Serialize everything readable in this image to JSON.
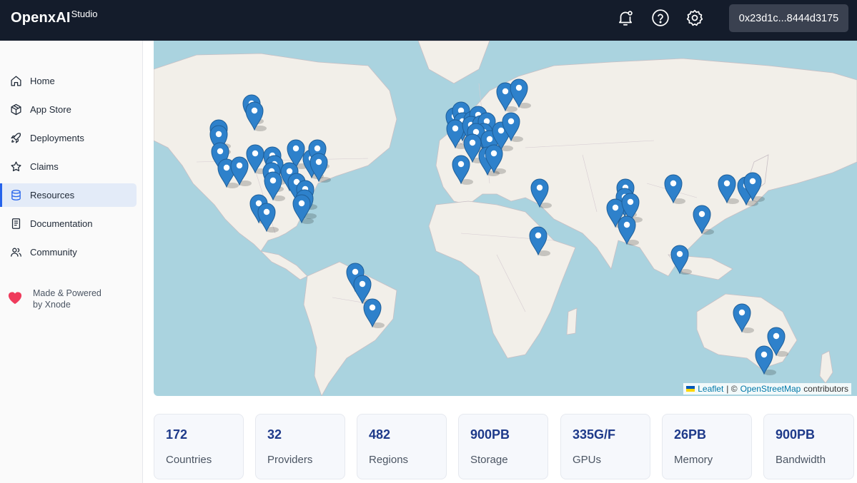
{
  "header": {
    "brand": "OpenxAI",
    "brand_sub": "Studio",
    "wallet": "0x23d1c...8444d3175",
    "icons": [
      "bell-icon",
      "help-icon",
      "settings-icon"
    ]
  },
  "sidebar": {
    "items": [
      {
        "label": "Home",
        "icon": "home-icon",
        "active": false
      },
      {
        "label": "App Store",
        "icon": "box-icon",
        "active": false
      },
      {
        "label": "Deployments",
        "icon": "rocket-icon",
        "active": false
      },
      {
        "label": "Claims",
        "icon": "star-icon",
        "active": false
      },
      {
        "label": "Resources",
        "icon": "database-icon",
        "active": true
      },
      {
        "label": "Documentation",
        "icon": "book-icon",
        "active": false
      },
      {
        "label": "Community",
        "icon": "users-icon",
        "active": false
      }
    ],
    "powered": "Made & Powered by Xnode"
  },
  "map": {
    "attribution_leaflet": "Leaflet",
    "attribution_sep": "| ©",
    "attribution_osm": "OpenStreetMap",
    "attribution_tail": "contributors"
  },
  "stats": [
    {
      "value": "172",
      "label": "Countries"
    },
    {
      "value": "32",
      "label": "Providers"
    },
    {
      "value": "482",
      "label": "Regions"
    },
    {
      "value": "900PB",
      "label": "Storage"
    },
    {
      "value": "335G/F",
      "label": "GPUs"
    },
    {
      "value": "26PB",
      "label": "Memory"
    },
    {
      "value": "900PB",
      "label": "Bandwidth"
    }
  ],
  "colors": {
    "topbar": "#141c2b",
    "accent": "#2563eb",
    "stat_value": "#1e3a8a",
    "marker": "#2e81cb",
    "water": "#aad3df",
    "land": "#f2efe9"
  }
}
